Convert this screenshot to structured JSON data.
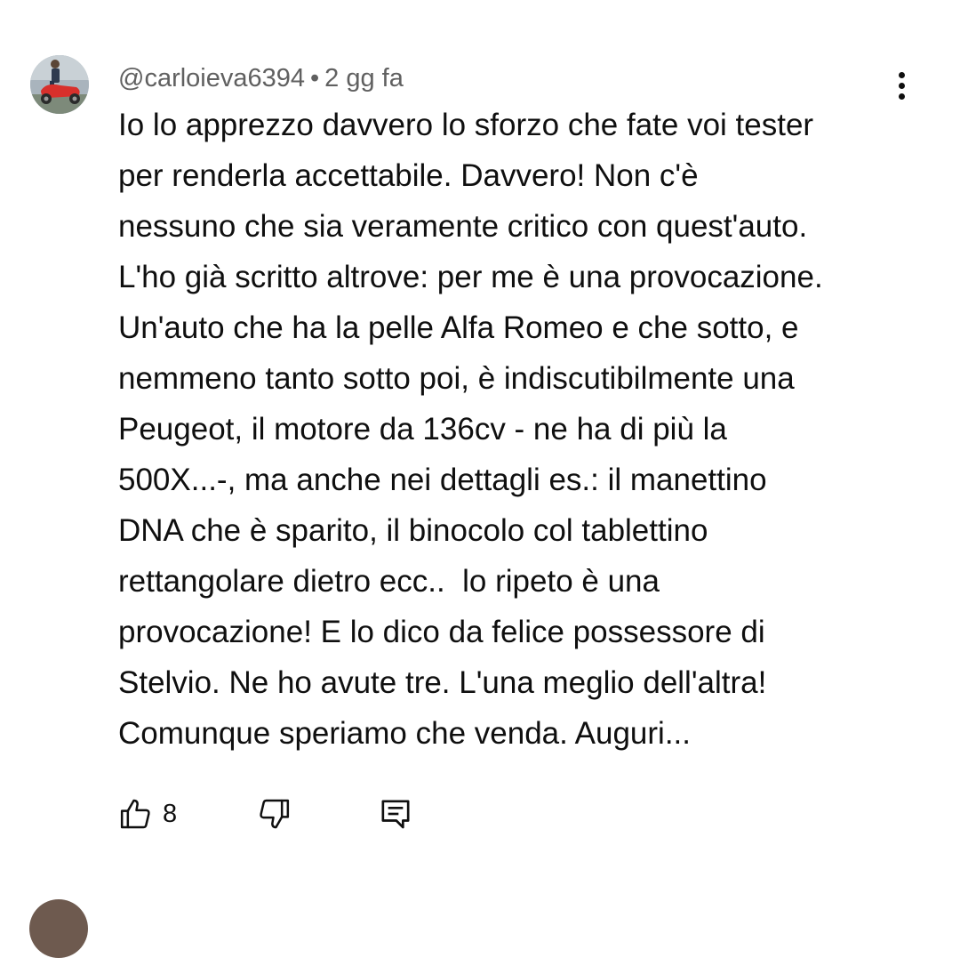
{
  "comment": {
    "author": "@carloieva6394",
    "separator": "•",
    "time": "2 gg fa",
    "lines": [
      "Io lo apprezzo davvero lo sforzo che fate voi tester",
      "per renderla accettabile. Davvero! Non c'è",
      "nessuno che sia veramente critico con quest'auto.",
      "L'ho già scritto altrove: per me è una provocazione.",
      "Un'auto che ha la pelle Alfa Romeo e che sotto, e",
      "nemmeno tanto sotto poi, è indiscutibilmente una",
      "Peugeot, il motore da 136cv - ne ha di più la",
      "500X...-, ma anche nei dettagli es.: il manettino",
      "DNA che è sparito, il binocolo col tablettino",
      "rettangolare dietro ecc..  lo ripeto è una",
      "provocazione! E lo dico da felice possessore di",
      "Stelvio. Ne ho avute tre. L'una meglio dell'altra!",
      "Comunque speriamo che venda. Auguri..."
    ],
    "likes": "8"
  },
  "icons": {
    "avatar": "user-avatar",
    "more": "more-vertical-icon",
    "like": "thumbs-up-icon",
    "dislike": "thumbs-down-icon",
    "reply": "reply-comment-icon"
  },
  "colors": {
    "text": "#0f0f0f",
    "meta": "#606060",
    "background": "#ffffff"
  }
}
